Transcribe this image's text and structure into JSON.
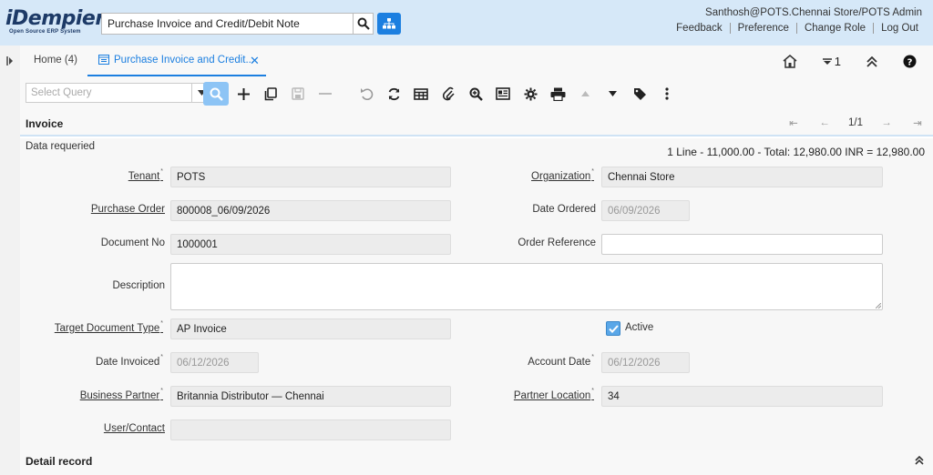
{
  "header": {
    "logo_main": "iDempiere",
    "logo_sub": "Open Source ERP System",
    "search_value": "Purchase Invoice and Credit/Debit Note",
    "user": "Santhosh@POTS.Chennai Store/POTS Admin",
    "links": [
      "Feedback",
      "Preference",
      "Change Role",
      "Log Out"
    ]
  },
  "tabs": {
    "home": "Home (4)",
    "active": "Purchase Invoice and Credit...",
    "close_glyph": "✕",
    "window_count": "1"
  },
  "toolbar": {
    "query_placeholder": "Select Query"
  },
  "section": {
    "title": "Invoice",
    "record_count": "1/1"
  },
  "form": {
    "status_left": "Data requeried",
    "status_right": "1 Line - 11,000.00 - Total: 12,980.00 INR = 12,980.00",
    "tenant_label": "Tenant",
    "tenant_value": "POTS",
    "organization_label": "Organization",
    "organization_value": "Chennai Store",
    "purchase_order_label": "Purchase Order",
    "purchase_order_value": "800008_06/09/2026",
    "date_ordered_label": "Date Ordered",
    "date_ordered_value": "06/09/2026",
    "document_no_label": "Document No",
    "document_no_value": "1000001",
    "order_reference_label": "Order Reference",
    "order_reference_value": "",
    "description_label": "Description",
    "description_value": "",
    "target_doc_type_label": "Target Document Type",
    "target_doc_type_value": "AP Invoice",
    "active_label": "Active",
    "date_invoiced_label": "Date Invoiced",
    "date_invoiced_value": "06/12/2026",
    "account_date_label": "Account Date",
    "account_date_value": "06/12/2026",
    "business_partner_label": "Business Partner",
    "business_partner_value": "Britannia Distributor — Chennai",
    "partner_location_label": "Partner Location",
    "partner_location_value": "34",
    "user_contact_label": "User/Contact",
    "user_contact_value": ""
  },
  "detail": {
    "title": "Detail record"
  },
  "colors": {
    "header_bg": "#d6e8f8",
    "accent": "#1c7fe0"
  }
}
